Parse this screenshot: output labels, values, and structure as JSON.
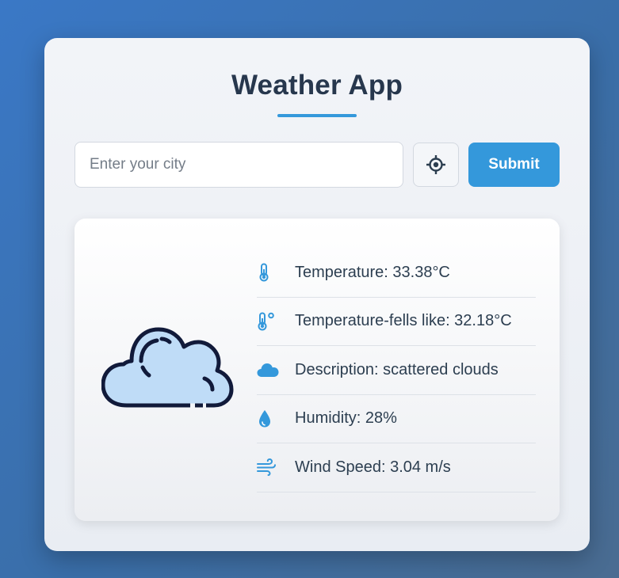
{
  "app": {
    "title": "Weather App"
  },
  "search": {
    "placeholder": "Enter your city",
    "value": "",
    "submit_label": "Submit",
    "locate_icon": "crosshair-icon"
  },
  "weather": {
    "image_icon": "cloud-icon",
    "details": [
      {
        "icon": "thermometer-icon",
        "text": "Temperature: 33.38°C"
      },
      {
        "icon": "thermometer-degree-icon",
        "text": "Temperature-fells like: 32.18°C"
      },
      {
        "icon": "cloud-icon",
        "text": "Description: scattered clouds"
      },
      {
        "icon": "droplet-icon",
        "text": "Humidity: 28%"
      },
      {
        "icon": "wind-icon",
        "text": "Wind Speed: 3.04 m/s"
      }
    ]
  },
  "colors": {
    "accent": "#3498db",
    "title": "#27374d",
    "cloud_fill": "#bfdcf7",
    "cloud_stroke": "#111a3a"
  }
}
